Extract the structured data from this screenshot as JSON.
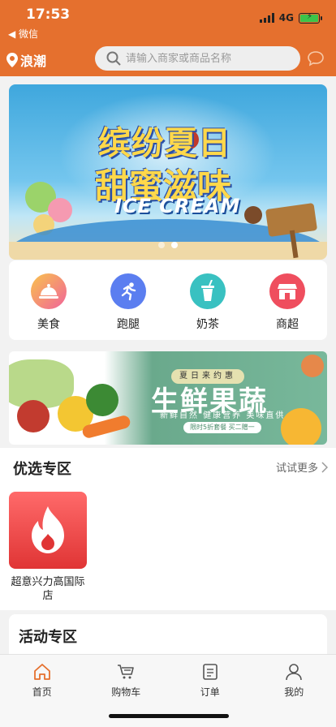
{
  "status": {
    "time": "17:53",
    "back_app": "◀ 微信",
    "network": "4G"
  },
  "header": {
    "location": "浪潮",
    "search_placeholder": "请输入商家或商品名称"
  },
  "banner": {
    "line1": "缤纷夏日",
    "line2": "甜蜜滋味",
    "english": "ICE CREAM",
    "active_dot": 1,
    "dot_count": 2
  },
  "categories": [
    {
      "label": "美食",
      "icon": "food-cloche-icon",
      "color": "#f2a13a"
    },
    {
      "label": "跑腿",
      "icon": "runner-icon",
      "color": "#5b7ef0"
    },
    {
      "label": "奶茶",
      "icon": "drink-cup-icon",
      "color": "#39c1c1"
    },
    {
      "label": "商超",
      "icon": "store-icon",
      "color": "#ef4e5e"
    }
  ],
  "promo": {
    "bubble": "夏日来约惠",
    "title": "生鲜果蔬",
    "subtitle": "新鲜自然 健康营养 美味直供",
    "tag": "限时5折套餐 买二赠一"
  },
  "preferred": {
    "title": "优选专区",
    "more": "试试更多",
    "shops": [
      {
        "name": "超意兴力高国际店"
      }
    ]
  },
  "activities": {
    "title": "活动专区"
  },
  "tabbar": [
    {
      "label": "首页",
      "icon": "home-icon",
      "active": true
    },
    {
      "label": "购物车",
      "icon": "cart-icon",
      "active": false
    },
    {
      "label": "订单",
      "icon": "order-list-icon",
      "active": false
    },
    {
      "label": "我的",
      "icon": "profile-icon",
      "active": false
    }
  ],
  "colors": {
    "brand": "#e5702e",
    "active_tab": "#e5702e"
  }
}
